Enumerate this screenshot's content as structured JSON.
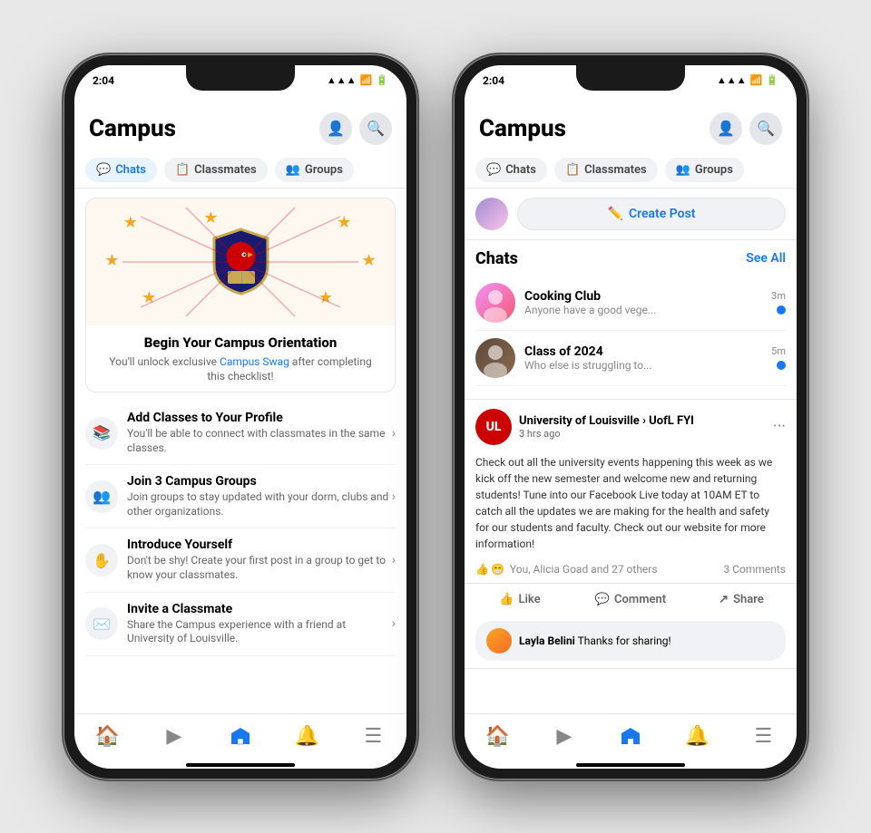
{
  "phone1": {
    "status": {
      "time": "2:04",
      "signal": "▲▲▲",
      "wifi": "wifi",
      "battery": "🔋"
    },
    "header": {
      "title": "Campus",
      "profile_icon": "👤",
      "search_icon": "🔍"
    },
    "tabs": [
      {
        "label": "Chats",
        "icon": "💬",
        "active": true
      },
      {
        "label": "Classmates",
        "icon": "📋",
        "active": false
      },
      {
        "label": "Groups",
        "icon": "👥",
        "active": false
      }
    ],
    "banner": {
      "title": "Begin Your Campus Orientation",
      "subtitle_before": "You'll unlock exclusive ",
      "subtitle_link": "Campus Swag",
      "subtitle_after": " after completing this checklist!"
    },
    "checklist": [
      {
        "icon": "📚",
        "title": "Add Classes to Your Profile",
        "desc": "You'll be able to connect with classmates in the same classes."
      },
      {
        "icon": "👥",
        "title": "Join 3 Campus Groups",
        "desc": "Join groups to stay updated with your dorm, clubs and other organizations."
      },
      {
        "icon": "✋",
        "title": "Introduce Yourself",
        "desc": "Don't be shy! Create your first post in a group to get to know your classmates."
      },
      {
        "icon": "✉️",
        "title": "Invite a Classmate",
        "desc": "Share the Campus experience with a friend at University of Louisville."
      }
    ],
    "nav": [
      "🏠",
      "▶",
      "▼",
      "🔔",
      "☰"
    ]
  },
  "phone2": {
    "status": {
      "time": "2:04"
    },
    "header": {
      "title": "Campus"
    },
    "tabs": [
      {
        "label": "Chats",
        "active": false
      },
      {
        "label": "Classmates",
        "active": false
      },
      {
        "label": "Groups",
        "active": false
      }
    ],
    "create_post": "Create Post",
    "chats_section": {
      "title": "Chats",
      "see_all": "See All"
    },
    "chats": [
      {
        "name": "Cooking Club",
        "preview": "Anyone have a good vege...",
        "time": "3m",
        "unread": true
      },
      {
        "name": "Class of 2024",
        "preview": "Who else is struggling to...",
        "time": "5m",
        "unread": true
      }
    ],
    "post": {
      "avatar_text": "UL",
      "author": "University of Louisville › UofL FYI",
      "time": "3 hrs ago",
      "body": "Check out all the university events happening this week as we kick off the new semester and welcome new and returning students! Tune into our Facebook Live today at 10AM ET to catch all the updates we are making for the health and safety for our students and faculty. Check out our website for more information!",
      "reactions": "You, Alicia Goad and 27 others",
      "comments": "3 Comments",
      "like_btn": "Like",
      "comment_btn": "Comment",
      "share_btn": "Share"
    },
    "comment": {
      "author": "Layla Belini",
      "text": "Thanks for sharing!"
    },
    "nav": [
      "🏠",
      "▶",
      "▼",
      "🔔",
      "☰"
    ]
  }
}
